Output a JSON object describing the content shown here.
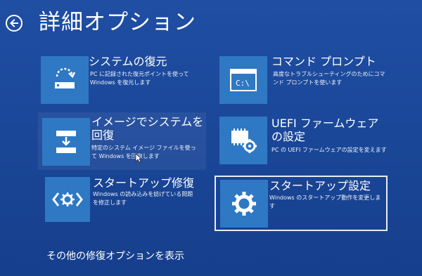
{
  "header": {
    "title": "詳細オプション"
  },
  "tiles": [
    {
      "title": "システムの復元",
      "desc": "PC に記録された復元ポイントを使って Windows を復元します",
      "icon": "system-restore-icon"
    },
    {
      "title": "コマンド プロンプト",
      "desc": "高度なトラブルシューティングのためにコマンド プロンプトを使います",
      "icon": "command-prompt-icon"
    },
    {
      "title": "イメージでシステムを回復",
      "desc": "特定のシステム イメージ ファイルを使って Windows を回復します",
      "icon": "system-image-recovery-icon"
    },
    {
      "title": "UEFI ファームウェアの設定",
      "desc": "PC の UEFI ファームウェアの設定を変えます",
      "icon": "uefi-firmware-icon"
    },
    {
      "title": "スタートアップ修復",
      "desc": "Windows の読み込みを妨げている問題を修正します",
      "icon": "startup-repair-icon"
    },
    {
      "title": "スタートアップ設定",
      "desc": "Windows のスタートアップ動作を変更します",
      "icon": "gear-icon"
    }
  ],
  "footer": {
    "more_options": "その他の修復オプションを表示"
  },
  "colors": {
    "background": "#1f4ea3",
    "tile_icon_bg": "#2f78c4",
    "focus_border": "#e8eef8"
  }
}
